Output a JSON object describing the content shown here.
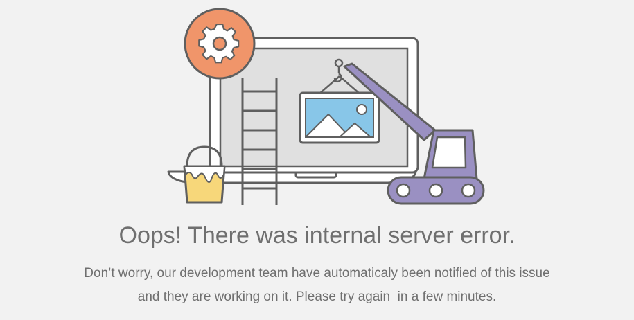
{
  "error": {
    "title": "Oops! There was internal server error.",
    "message_line_1": "Don’t worry, our development team have automaticaly been notified of this issue",
    "message_line_2": "and they are working on it. Please try again  in a few minutes."
  },
  "colors": {
    "background": "#f2f2f2",
    "outline": "#5f5f5f",
    "screen": "#e0e0e0",
    "gear_badge": "#f0956a",
    "crane": "#9a90c2",
    "paint_bucket": "#f7d77a",
    "picture_sky": "#88c6e8",
    "text": "#6f6f6f"
  },
  "icons": {
    "gear": "gear-icon",
    "picture": "image-icon",
    "crane": "crane-icon",
    "ladder": "ladder-icon",
    "paint_bucket": "paint-bucket-icon"
  }
}
